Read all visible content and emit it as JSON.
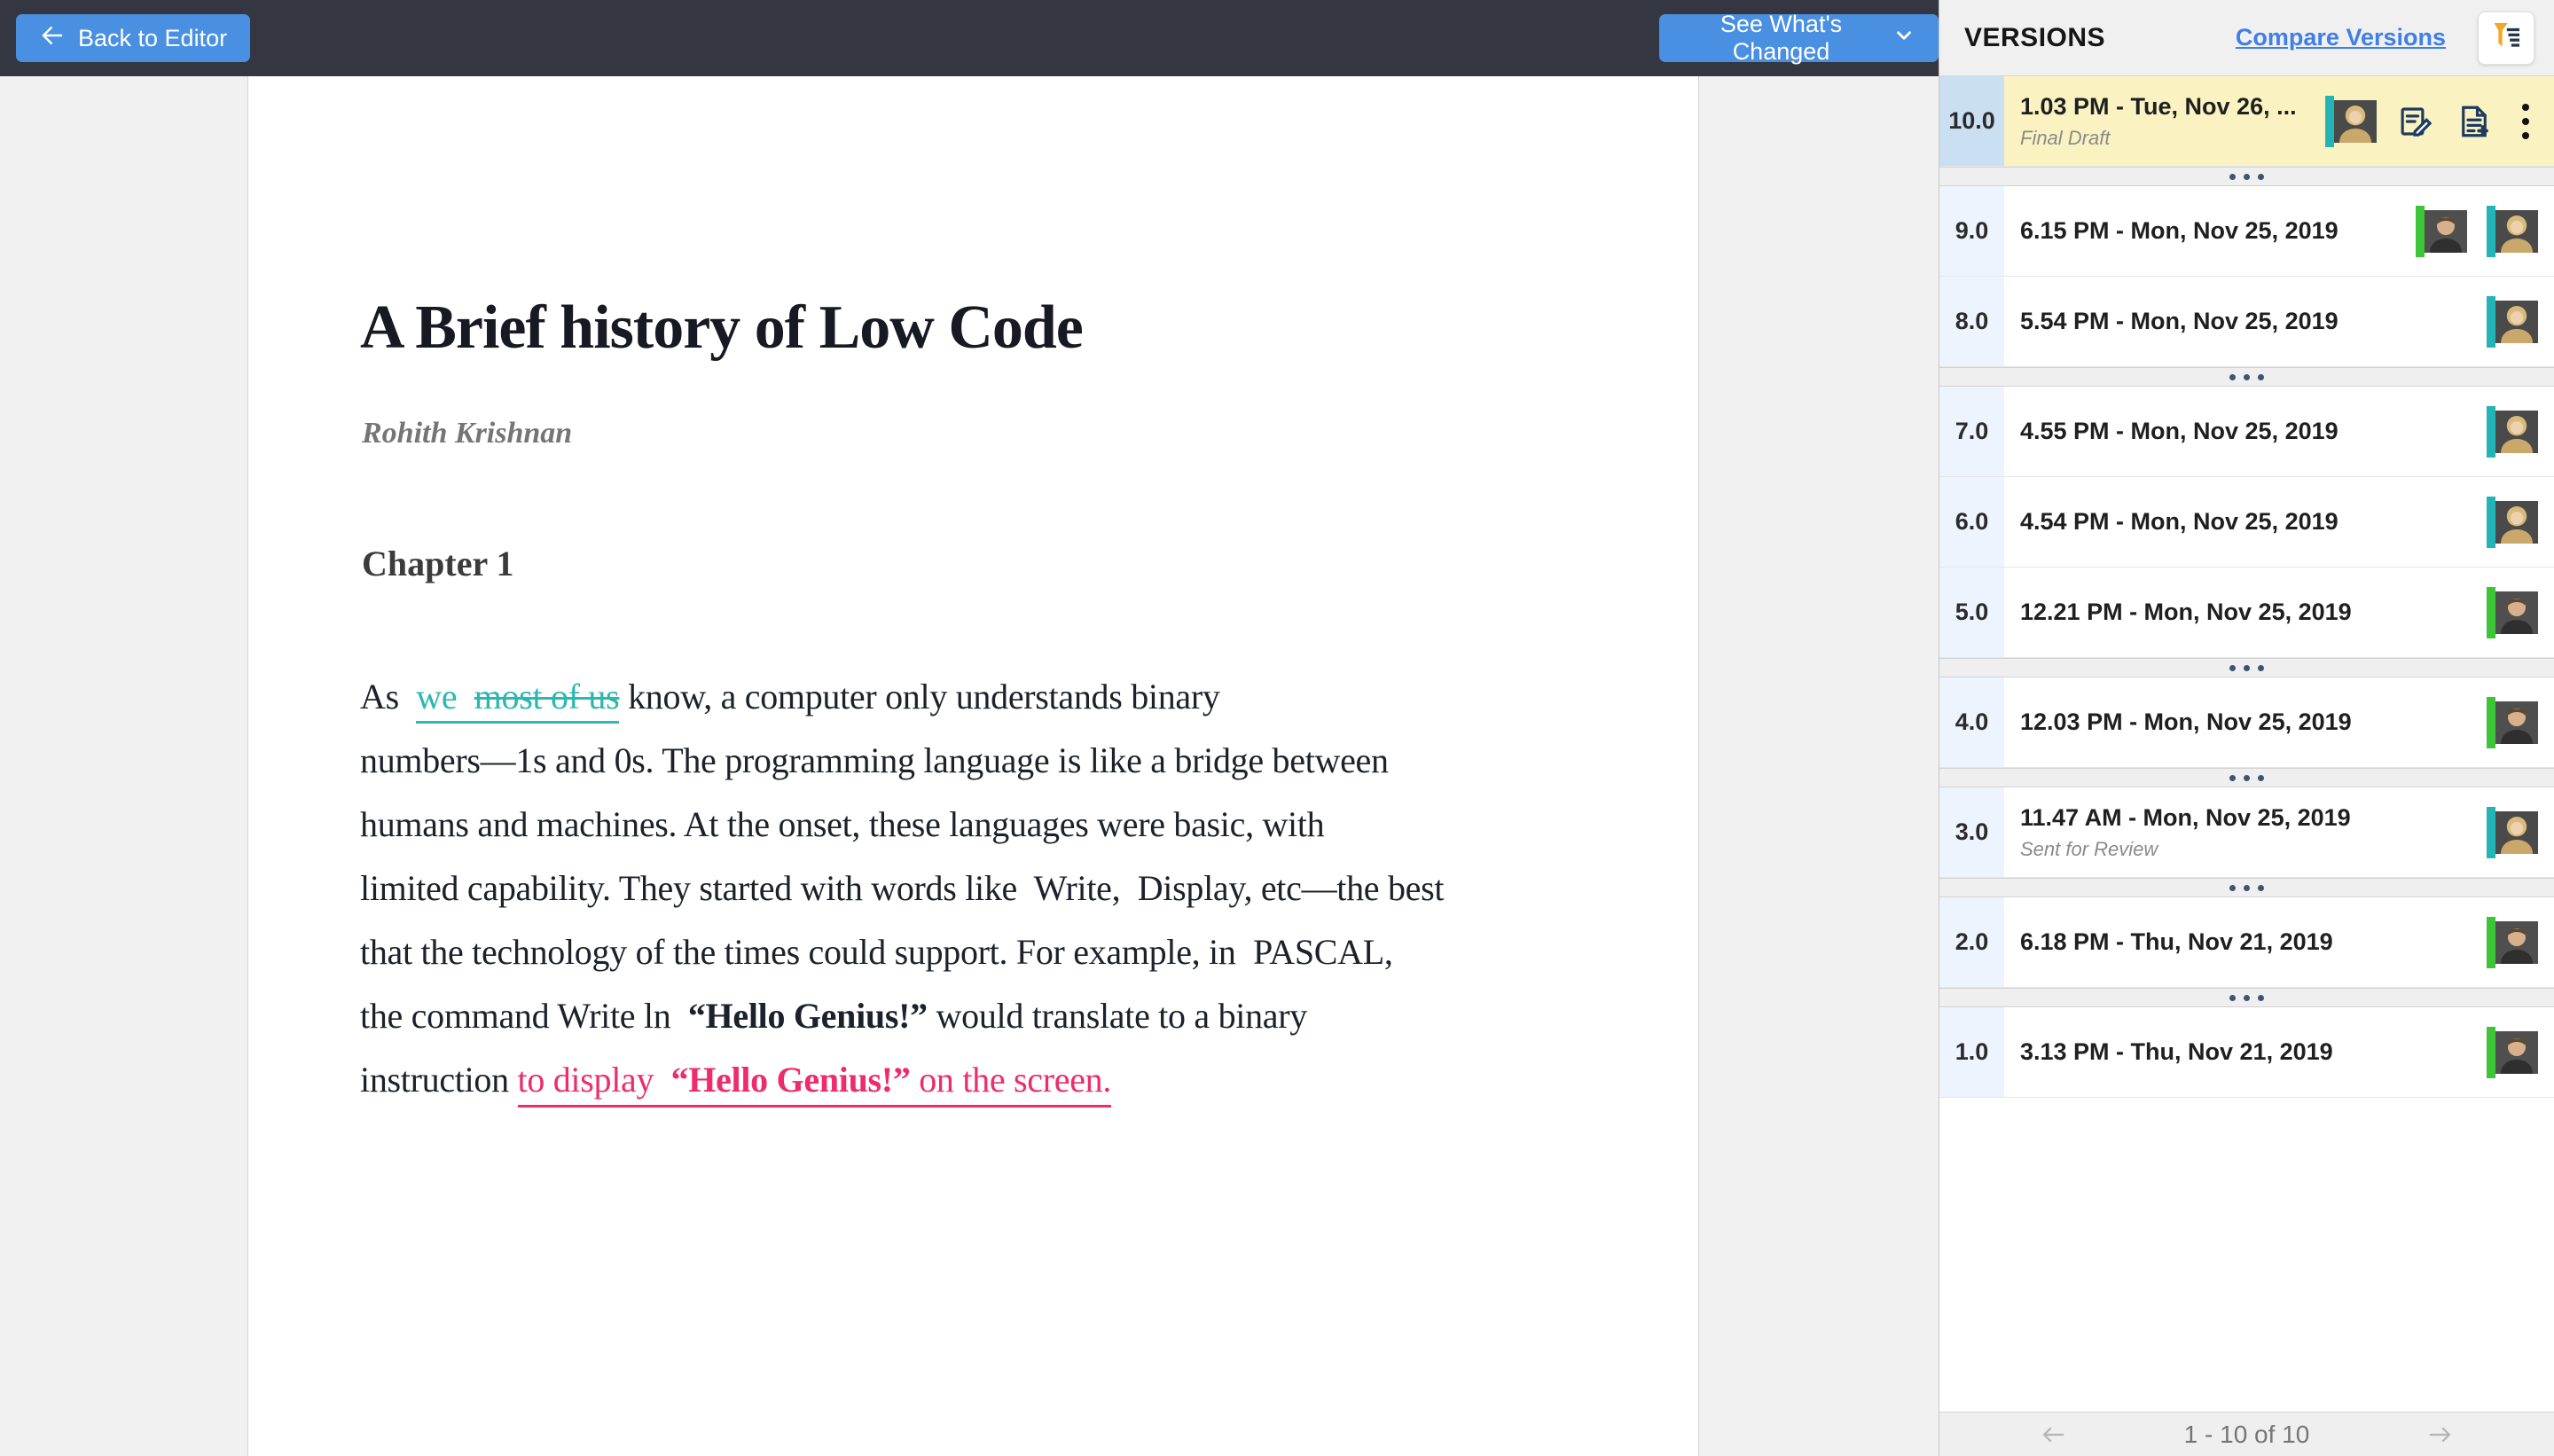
{
  "topbar": {
    "back_label": "Back to Editor",
    "changes_label": "See What's Changed"
  },
  "panel": {
    "title": "VERSIONS",
    "compare_label": "Compare Versions",
    "filter_icon": "filter-funnel-icon",
    "pagination": {
      "range": "1 - 10 of 10"
    },
    "rows": [
      {
        "version": "10.0",
        "time": "1.03 PM - Tue, Nov 26, ...",
        "subtitle": "Final Draft",
        "selected": true,
        "avatars": [
          "teal-woman"
        ],
        "actions": [
          "edit-version-note-icon",
          "save-as-new-version-icon",
          "more-options-icon"
        ]
      },
      {
        "version": "9.0",
        "time": "6.15 PM - Mon, Nov 25, 2019",
        "avatars": [
          "green-man",
          "teal-woman"
        ]
      },
      {
        "version": "8.0",
        "time": "5.54 PM - Mon, Nov 25, 2019",
        "avatars": [
          "teal-woman"
        ]
      },
      {
        "version": "7.0",
        "time": "4.55 PM - Mon, Nov 25, 2019",
        "avatars": [
          "teal-woman"
        ]
      },
      {
        "version": "6.0",
        "time": "4.54 PM - Mon, Nov 25, 2019",
        "avatars": [
          "teal-woman"
        ]
      },
      {
        "version": "5.0",
        "time": "12.21 PM - Mon, Nov 25, 2019",
        "avatars": [
          "green-man"
        ]
      },
      {
        "version": "4.0",
        "time": "12.03 PM - Mon, Nov 25, 2019",
        "avatars": [
          "green-man"
        ]
      },
      {
        "version": "3.0",
        "time": "11.47 AM - Mon, Nov 25, 2019",
        "subtitle": "Sent for Review",
        "avatars": [
          "teal-woman"
        ]
      },
      {
        "version": "2.0",
        "time": "6.18 PM - Thu, Nov 21, 2019",
        "avatars": [
          "green-man"
        ]
      },
      {
        "version": "1.0",
        "time": "3.13 PM - Thu, Nov 21, 2019",
        "avatars": [
          "green-man"
        ]
      }
    ]
  },
  "document": {
    "title": "A Brief history of Low Code",
    "author": "Rohith Krishnan",
    "chapter": "Chapter 1",
    "para": {
      "l1": {
        "pre": "As  ",
        "ins": "we",
        "gap": "  ",
        "del": "most of us",
        "post": " know, a computer only understands binary"
      },
      "l2": "numbers—1s and 0s. The programming language is like a bridge between",
      "l3": "humans and machines. At the onset, these languages were basic, with",
      "l4": "limited capability. They started with words like  Write,  Display, etc—the best",
      "l5": "that the technology of the times could support. For example, in  PASCAL,",
      "l6": {
        "pre": "the command Write ln  ",
        "bold": "“Hello Genius!”",
        "post": " would translate to a binary"
      },
      "l7": {
        "pre": "instruction ",
        "ins1": "to display  ",
        "insBold": "“Hello Genius!”",
        "ins2": " on the screen."
      }
    }
  },
  "colors": {
    "topbar_bg": "#343741",
    "accent_blue": "#4a90e2",
    "link_blue": "#3e7fe8",
    "selected_row_yellow": "#faf3c1",
    "version_cell_blue": "#edf4fd",
    "selected_version_cell_blue": "#cbdff2",
    "track_insert_teal": "#2bb8ae",
    "track_insert_pink": "#ee2b6c",
    "funnel_orange": "#f5a623"
  }
}
